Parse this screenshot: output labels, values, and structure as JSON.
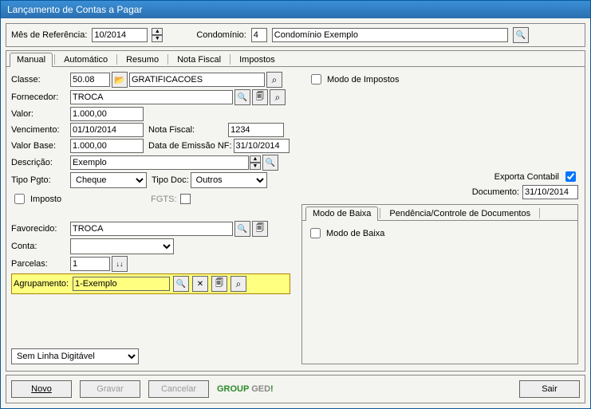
{
  "window": {
    "title": "Lançamento de Contas a Pagar"
  },
  "topbar": {
    "mes_ref_label": "Mês de Referência:",
    "mes_ref_value": "10/2014",
    "condominio_label": "Condomínio:",
    "condominio_code": "4",
    "condominio_name": "Condomínio Exemplo"
  },
  "tabs": {
    "manual": "Manual",
    "automatico": "Automático",
    "resumo": "Resumo",
    "nota_fiscal": "Nota Fiscal",
    "impostos": "Impostos"
  },
  "form": {
    "classe_label": "Classe:",
    "classe_code": "50.08",
    "classe_desc": "GRATIFICACOES",
    "fornecedor_label": "Fornecedor:",
    "fornecedor": "TROCA",
    "valor_label": "Valor:",
    "valor": "1.000,00",
    "vencimento_label": "Vencimento:",
    "vencimento": "01/10/2014",
    "nf_label": "Nota Fiscal:",
    "nf": "1234",
    "valor_base_label": "Valor Base:",
    "valor_base": "1.000,00",
    "emissao_label": "Data de Emissão NF:",
    "emissao": "31/10/2014",
    "descricao_label": "Descrição:",
    "descricao": "Exemplo",
    "tipo_pgto_label": "Tipo Pgto:",
    "tipo_pgto": "Cheque",
    "tipo_doc_label": "Tipo Doc:",
    "tipo_doc": "Outros",
    "imposto_label": "Imposto",
    "fgts_label": "FGTS:",
    "fgts": "",
    "favorecido_label": "Favorecido:",
    "favorecido": "TROCA",
    "conta_label": "Conta:",
    "conta": "",
    "parcelas_label": "Parcelas:",
    "parcelas": "1",
    "agrupamento_label": "Agrupamento:",
    "agrupamento": "1-Exemplo"
  },
  "right": {
    "modo_impostos": "Modo de Impostos",
    "exporta_contabil": "Exporta Contabil",
    "documento_label": "Documento:",
    "documento": "31/10/2014"
  },
  "subpanel": {
    "tab1": "Modo de Baixa",
    "tab2": "Pendência/Controle de Documentos",
    "check": "Modo de Baixa"
  },
  "bottom": {
    "combo": "Sem Linha Digitável"
  },
  "buttons": {
    "novo": "Novo",
    "gravar": "Gravar",
    "cancelar": "Cancelar",
    "groupged": "GROUP GED!",
    "sair": "Sair"
  }
}
